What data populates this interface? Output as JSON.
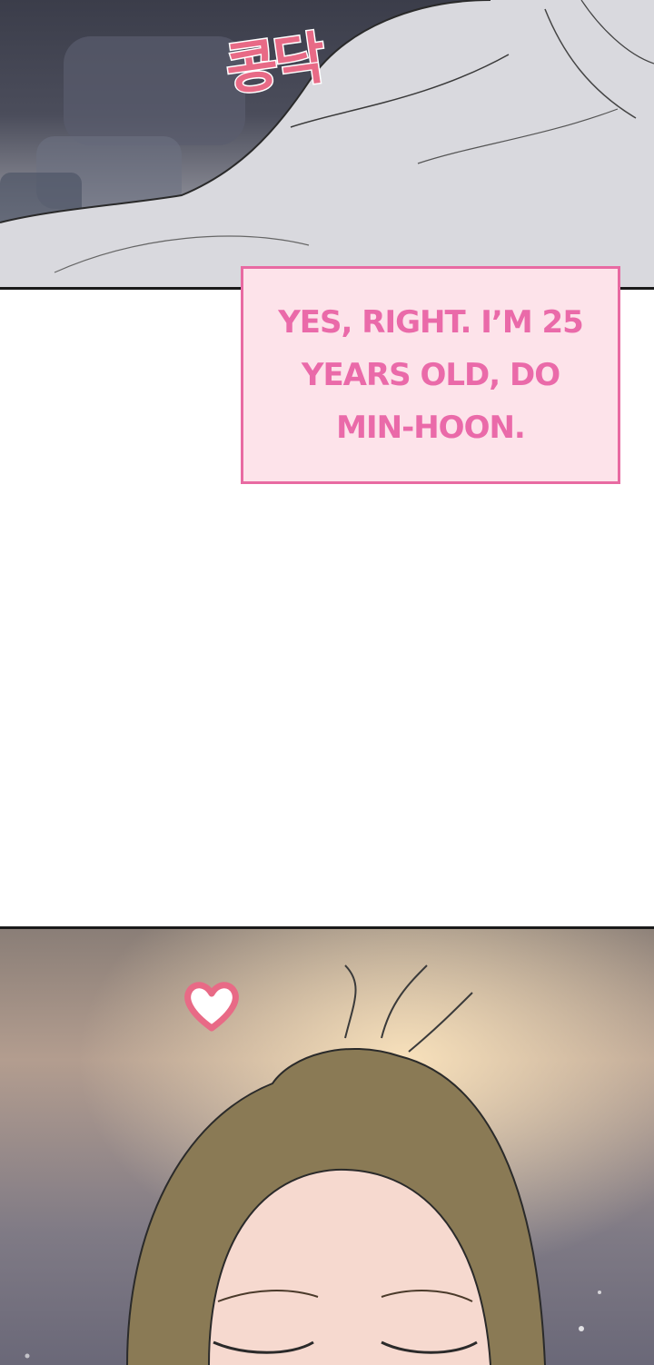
{
  "panels": {
    "top": {
      "sfx_text": "콩닥",
      "sfx_color": "#e86a86"
    },
    "caption": {
      "text": "YES, RIGHT. I’M 25 YEARS OLD, DO MIN-HOON.",
      "text_color": "#ea6aa9",
      "background_color": "#fde3ea",
      "border_color": "#e86aa2"
    },
    "bottom": {
      "icon": "heart-icon",
      "icon_color": "#e86a86"
    }
  }
}
